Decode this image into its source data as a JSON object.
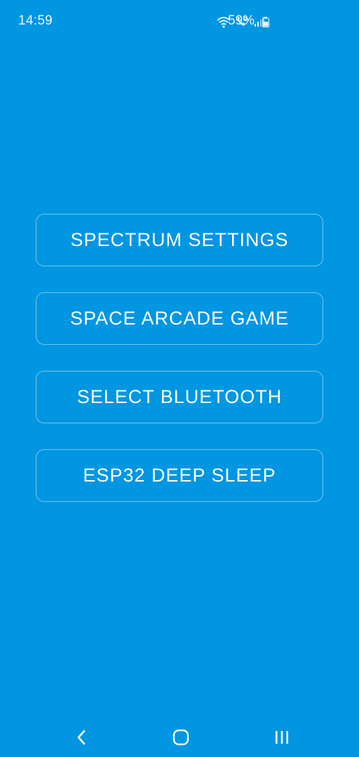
{
  "status_bar": {
    "time": "14:59",
    "battery_percent": "59%",
    "icons": [
      "wifi-calling-icon",
      "volte-call-icon",
      "signal-icon",
      "battery-icon"
    ]
  },
  "menu": {
    "items": [
      {
        "label": "SPECTRUM SETTINGS"
      },
      {
        "label": "SPACE ARCADE GAME"
      },
      {
        "label": "SELECT BLUETOOTH"
      },
      {
        "label": "ESP32 DEEP SLEEP"
      }
    ]
  },
  "nav_bar": {
    "icons": [
      "back-icon",
      "home-icon",
      "recents-icon"
    ]
  },
  "colors": {
    "background": "#0096e1",
    "text": "#ffffff",
    "button_border": "rgba(255,255,255,0.45)"
  }
}
